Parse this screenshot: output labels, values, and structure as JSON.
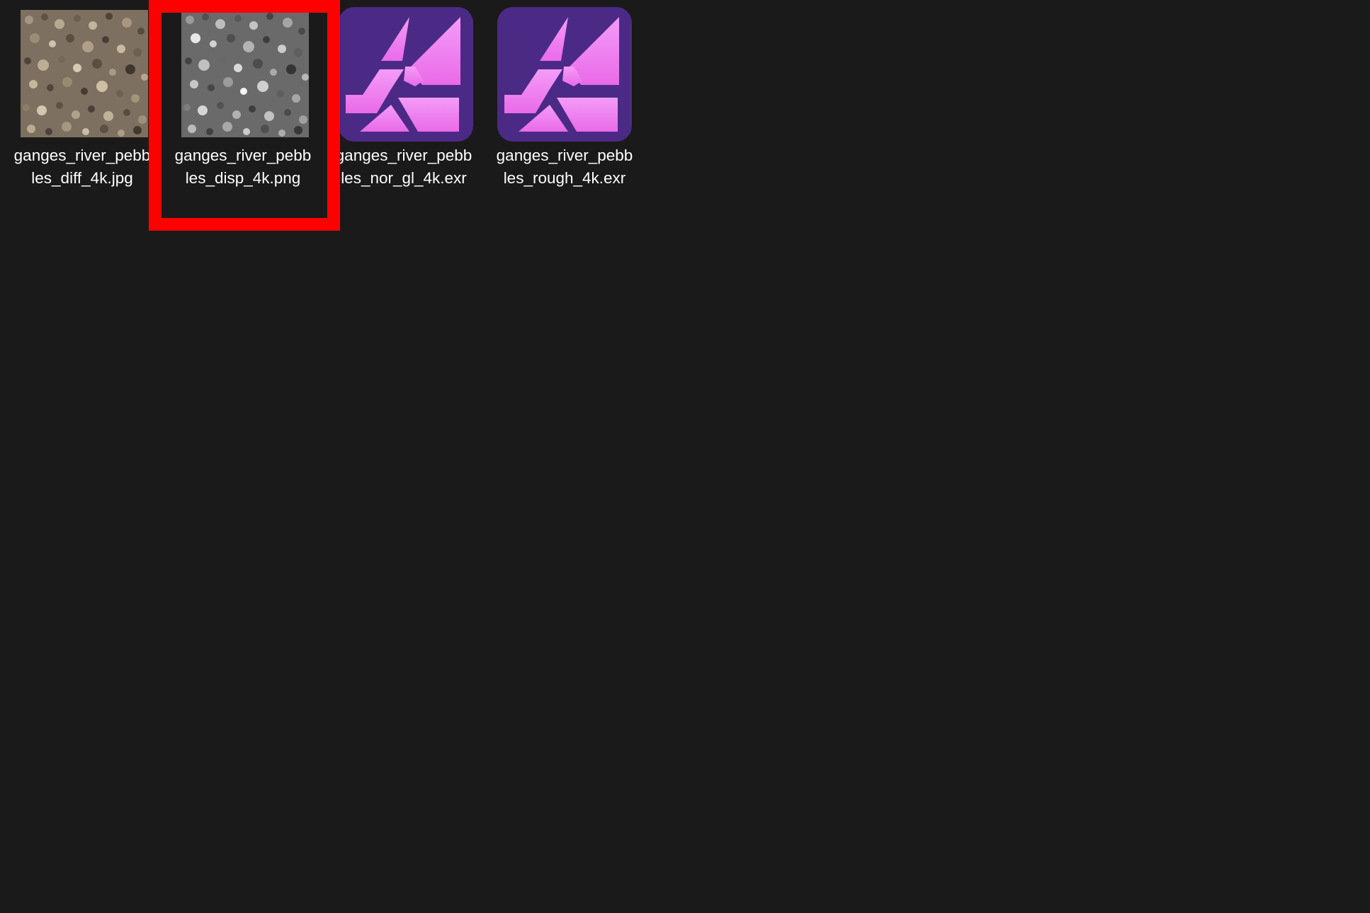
{
  "files": [
    {
      "name": "ganges_river_pebbles_diff_4k.jpg",
      "icon": "color-pebbles-thumbnail"
    },
    {
      "name": "ganges_river_pebbles_disp_4k.png",
      "icon": "grayscale-pebbles-thumbnail",
      "highlighted": true
    },
    {
      "name": "ganges_river_pebbles_nor_gl_4k.exr",
      "icon": "affinity-photo-icon"
    },
    {
      "name": "ganges_river_pebbles_rough_4k.exr",
      "icon": "affinity-photo-icon"
    }
  ],
  "colors": {
    "background": "#1a1a1a",
    "highlight": "#ff0000",
    "text": "#ffffff",
    "affinity_purple_dark": "#4b2a86",
    "affinity_pink": "#f28af5"
  }
}
